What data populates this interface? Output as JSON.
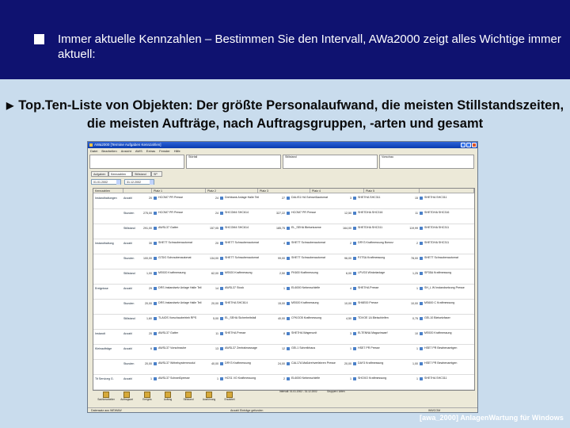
{
  "slide": {
    "headline": "Immer aktuelle Kennzahlen – Bestimmen Sie den Intervall, AWa2000 zeigt alles Wichtige immer aktuell:",
    "subheadline": "Top.Ten-Liste von Objekten: Der größte Personalaufwand, die meisten Stillstandszeiten, die meisten Aufträge, nach Auftragsgruppen, -arten und gesamt",
    "footer": "[awa_2000] AnlagenWartung für Windows",
    "colors": {
      "band": "#0f1270",
      "background": "#c9dced"
    }
  },
  "window": {
    "title": "AWa2000   [Termine   Aufgaben   Kennzahlen]",
    "menu": [
      "Datei",
      "Bearbeiten",
      "Ansicht",
      "AWS",
      "Extras",
      "Fenster",
      "Hilfe"
    ],
    "info_boxes": [
      "",
      "Störfall",
      "Stillstand",
      "Vorschau"
    ],
    "tabs": [
      "Aufgaben",
      "Kennzahlen",
      "Stillstand",
      "SP"
    ],
    "filters": [
      "01.01.2002",
      "31.12.2002"
    ],
    "columns": [
      "Kennzahlen",
      "",
      "Platz 1",
      "",
      "Platz 2",
      "",
      "Platz 3",
      "",
      "Platz 4",
      "",
      "Platz 5",
      ""
    ],
    "rows": [
      {
        "group": "Instandhaltungen",
        "measure": "Anzahl",
        "cells": [
          [
            "20",
            "HCOM7 PR Presse"
          ],
          [
            "24",
            "Drehbank Anlage Halle Teil"
          ],
          [
            "27",
            "DALIS1 HA Schweißautomat"
          ],
          [
            "3",
            "SHE7HA SHC311"
          ],
          [
            "15",
            "SHE7HA SHC311"
          ]
        ]
      },
      {
        "group": "",
        "measure": "Stunden",
        "cells": [
          [
            "275,00",
            "HCOM7 PR Presse"
          ],
          [
            "24",
            "SHCOM4 SHC614"
          ],
          [
            "327,22",
            "HCOM7 PR Presse"
          ],
          [
            "12,50",
            "SHE7DHA SHC316"
          ],
          [
            "11",
            "SHE7DHA SHC316"
          ]
        ]
      },
      {
        "group": "",
        "measure": "Stillstand",
        "cells": [
          [
            "291,00",
            "AWSL37 Gatter"
          ],
          [
            "157,05",
            "SHCOM4 SHC614"
          ],
          [
            "185,75",
            "EL_SEHA Bleisetzarme"
          ],
          [
            "164,00",
            "SHE7DHA SHC311"
          ],
          [
            "119,99",
            "SHE7DHA SHC311"
          ]
        ]
      },
      {
        "group": "Instandhaltung",
        "measure": "Anzahl",
        "cells": [
          [
            "30",
            "SHE7T Schraubenautomat"
          ],
          [
            "20",
            "SHE7T Schraubenautomat"
          ],
          [
            "4",
            "SHE7T Schraubenautomat"
          ],
          [
            "2",
            "DRY3 Kraftmessung Borsnz"
          ],
          [
            "2",
            "SHE7DHA SHC311"
          ]
        ]
      },
      {
        "group": "",
        "measure": "Stunden",
        "cells": [
          [
            "100,00",
            "G7DG Schraubenautomat"
          ],
          [
            "134,00",
            "SHE7T Schraubenautomat"
          ],
          [
            "99,00",
            "SHE7T Schraubenautomat"
          ],
          [
            "96,00",
            "PJTSA Kraftmessung"
          ],
          [
            "78,00",
            "SHE7T Schraubenautomat"
          ]
        ]
      },
      {
        "group": "",
        "measure": "Stillstand",
        "cells": [
          [
            "1,00",
            "MS920 Kraftmessung"
          ],
          [
            "62,00",
            "MS920 Kraftmessung"
          ],
          [
            "2,50",
            "FK600 Kraftmessung"
          ],
          [
            "6,00",
            "LPVG5 Winkelanlage"
          ],
          [
            "1,25",
            "SP35A Kraftmessung"
          ]
        ]
      },
      {
        "group": "Ereignisse",
        "measure": "Anzahl",
        "cells": [
          [
            "29",
            "DRS Instandsetz Anlage Halle Teil"
          ],
          [
            "14",
            "AWSL37 Stock"
          ],
          [
            "1",
            "EL6000 Nebenschleife"
          ],
          [
            "4",
            "SHE7HA Presse"
          ],
          [
            "1",
            "SH_L W Instandsetzung Presse"
          ]
        ]
      },
      {
        "group": "",
        "measure": "Stunden",
        "cells": [
          [
            "20,00",
            "DRS Instandsetz Anlage Halle Teil"
          ],
          [
            "20,00",
            "SHE7HA SHC614"
          ],
          [
            "15,00",
            "MS920 Kraftmessung"
          ],
          [
            "10,00",
            "SH6E00 Presse"
          ],
          [
            "10,00",
            "MS600 C Kraftmessung"
          ]
        ]
      },
      {
        "group": "",
        "measure": "Stillstand",
        "cells": [
          [
            "1,60",
            "TLAIOS Vorschaubetrieb RPS"
          ],
          [
            "5,00",
            "EL_SEHA Sicherheitsfall"
          ],
          [
            "40,00",
            "CFKOO5 Kraftmessung"
          ],
          [
            "4,50",
            "TDVOE 1A Bleischleifen"
          ],
          [
            "0,75",
            "GEL10 Bleisetzfaser"
          ]
        ]
      },
      {
        "group": "Instandt",
        "measure": "Anzahl",
        "cells": [
          [
            "20",
            "AWSL37 Gatter"
          ],
          [
            "11",
            "SHE7HA Presse"
          ],
          [
            "8",
            "SHE7HA Wagenunit"
          ],
          [
            "3",
            "ELTENNA Magazinwarf"
          ],
          [
            "10",
            "MS920 Kraftmessung"
          ]
        ]
      },
      {
        "group": "Kleinaufträge",
        "measure": "Anzahl",
        "cells": [
          [
            "6",
            "AWSL37 Vorschraube"
          ],
          [
            "13",
            "AWSL37 Zentralmassage"
          ],
          [
            "12",
            "GEL1 Schreibhaus"
          ],
          [
            "1",
            "HSE7 PR Presse"
          ],
          [
            "1",
            "HSE7 PR Bewbenamtgen"
          ]
        ]
      },
      {
        "group": "",
        "measure": "Stunden",
        "cells": [
          [
            "20,00",
            "AWSL37 Wirbelsystemmodul"
          ],
          [
            "40,00",
            "DRY3 Kraftmessung"
          ],
          [
            "24,00",
            "CAL17A Maßdrehverfahren Presse"
          ],
          [
            "20,00",
            "DAY3 Kraftmessung"
          ],
          [
            "1,00",
            "HSE7 PR Bewbenamtgen"
          ]
        ]
      },
      {
        "group": "Tit Serviceg G.",
        "measure": "Anzahl",
        "cells": [
          [
            "1",
            "AWSL37 Schweißpresse"
          ],
          [
            "1",
            "HCS1 VO Kraftmessung"
          ],
          [
            "2",
            "EL6000 Nebenschleife"
          ],
          [
            "1",
            "SHOXO Kraftmessung"
          ],
          [
            "1",
            "SHE7HA SHC311"
          ]
        ]
      }
    ],
    "toolbar": [
      {
        "label": "Sachbearbeiter"
      },
      {
        "label": "Auftragsart"
      },
      {
        "label": "Ereignis"
      },
      {
        "label": "Auftrag"
      },
      {
        "label": "Stillstand"
      },
      {
        "label": "Ausführung"
      },
      {
        "label": "Ersatzteil"
      }
    ],
    "toolbar_notes": [
      "Intervall: 01.01.2002 - 31.12.2002",
      "Gruppen / Arten"
    ],
    "status": [
      "Datensatz aus WEWAW",
      "Anzahl Einträge gefunden",
      "WWCOM"
    ]
  }
}
